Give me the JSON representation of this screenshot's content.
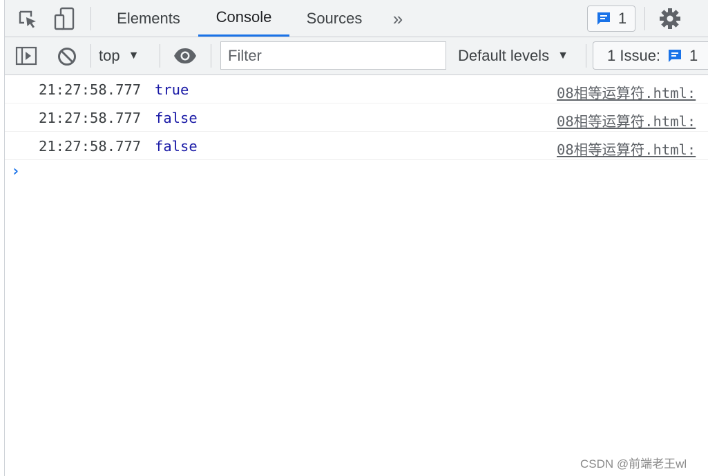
{
  "tabs": {
    "elements": "Elements",
    "console": "Console",
    "sources": "Sources",
    "more": "»"
  },
  "issues_badge": {
    "count": "1"
  },
  "toolbar": {
    "context": "top",
    "filter_placeholder": "Filter",
    "levels": "Default levels",
    "issues_label": "1 Issue:",
    "issues_count": "1"
  },
  "messages": [
    {
      "time": "21:27:58.777",
      "value": "true",
      "source": "08相等运算符.html:"
    },
    {
      "time": "21:27:58.777",
      "value": "false",
      "source": "08相等运算符.html:"
    },
    {
      "time": "21:27:58.777",
      "value": "false",
      "source": "08相等运算符.html:"
    }
  ],
  "prompt": "›",
  "watermark": "CSDN @前端老王wl",
  "colors": {
    "accent": "#1a73e8",
    "value_text": "#1a1aa6",
    "toolbar_bg": "#f1f3f4"
  },
  "icons": [
    "inspect-icon",
    "device-toolbar-icon",
    "chevron-double-right-icon",
    "message-icon",
    "gear-icon",
    "sidebar-icon",
    "clear-console-icon",
    "eye-icon",
    "caret-down-icon"
  ]
}
